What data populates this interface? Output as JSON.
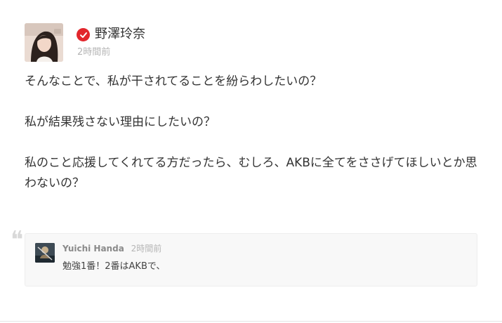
{
  "post": {
    "author": {
      "name": "野澤玲奈",
      "verified_color": "#e2262c",
      "avatar_icon": "profile-photo"
    },
    "time": "2時間前",
    "paragraphs": [
      "そんなことで、私が干されてることを紛らわしたいの？",
      "私が結果残さない理由にしたいの？",
      "私のこと応援してくれてる方だったら、むしろ、AKBに全てをささげてほしいとか思わないの？"
    ]
  },
  "reply": {
    "author": "Yuichi Handa",
    "time": "2時間前",
    "text": "勉強1番！2番はAKBで、",
    "avatar_icon": "profile-photo"
  },
  "colors": {
    "muted_text": "#b5b5b5",
    "reply_background": "#f8f8f8",
    "verified_badge": "#e2262c"
  }
}
